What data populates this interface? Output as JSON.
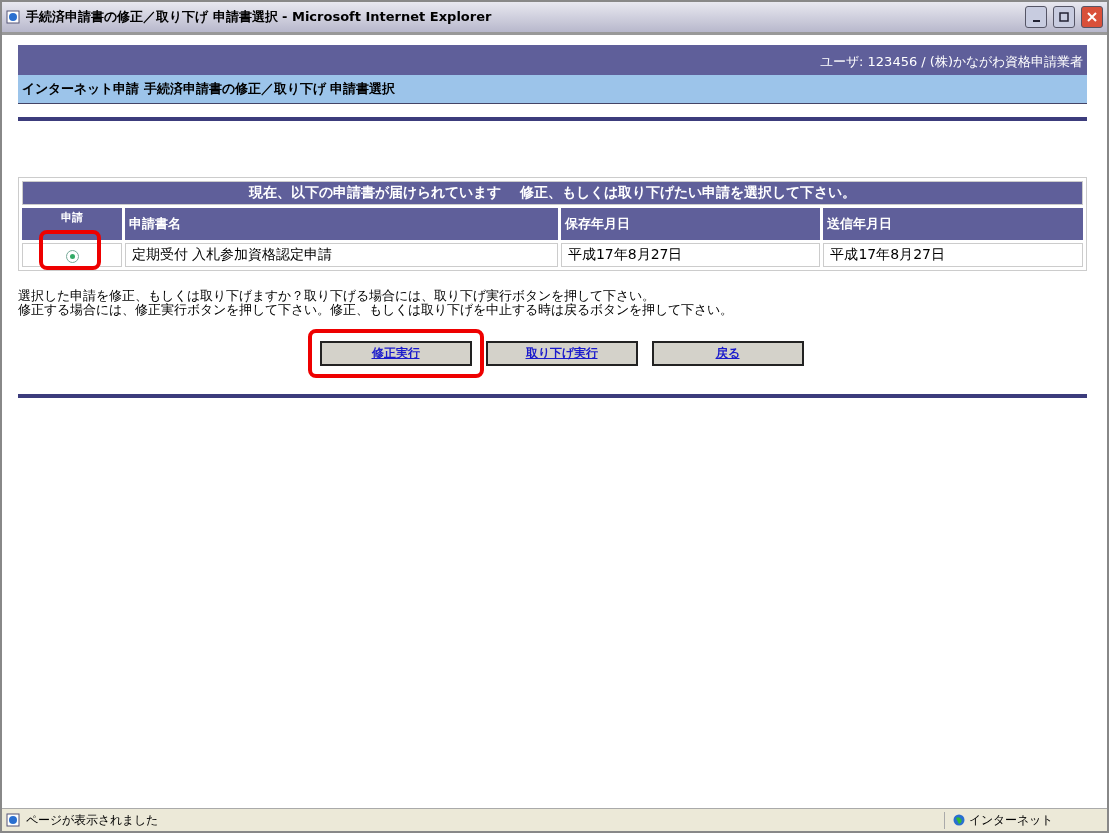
{
  "window": {
    "title": "手続済申請書の修正／取り下げ 申請書選択 - Microsoft Internet Explorer"
  },
  "user_bar": {
    "text": "ユーザ: 123456 / (株)かながわ資格申請業者"
  },
  "breadcrumb": {
    "text": "インターネット申請  手続済申請書の修正／取り下げ  申請書選択"
  },
  "table": {
    "caption": "現在、以下の申請書が届けられています　 修正、もしくは取り下げたい申請を選択して下さい。",
    "columns": [
      "申請",
      "申請書名",
      "保存年月日",
      "送信年月日"
    ],
    "rows": [
      {
        "selected": true,
        "name": "定期受付 入札参加資格認定申請",
        "saved": "平成17年8月27日",
        "sent": "平成17年8月27日"
      }
    ]
  },
  "instructions": [
    "選択した申請を修正、もしくは取り下げますか？取り下げる場合には、取り下げ実行ボタンを押して下さい。",
    "修正する場合には、修正実行ボタンを押して下さい。修正、もしくは取り下げを中止する時は戻るボタンを押して下さい。"
  ],
  "buttons": [
    {
      "label": "修正実行",
      "highlighted": true
    },
    {
      "label": "取り下げ実行",
      "highlighted": false
    },
    {
      "label": "戻る",
      "highlighted": false
    }
  ],
  "status_bar": {
    "message": "ページが表示されました",
    "zone": "インターネット"
  }
}
